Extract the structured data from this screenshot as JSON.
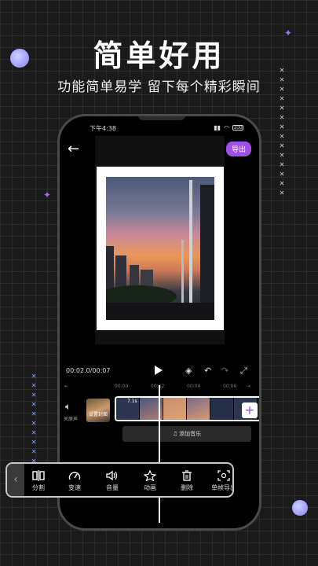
{
  "headline": "简单好用",
  "subheadline": "功能简单易学  留下每个精彩瞬间",
  "status_bar": {
    "time": "下午4:38",
    "battery": "100"
  },
  "editor": {
    "export_label": "导出",
    "time_display": "00:02.0/00:07",
    "ruler": [
      "00:00",
      "00:02",
      "00:04",
      "00:06"
    ],
    "sound_label": "关原声",
    "cover_label": "设置封面",
    "clip_duration": "7.1s",
    "add_music_label": "添加音乐"
  },
  "toolbar": {
    "items": [
      {
        "label": "分割",
        "icon": "split-icon"
      },
      {
        "label": "变速",
        "icon": "speed-icon"
      },
      {
        "label": "音量",
        "icon": "volume-icon"
      },
      {
        "label": "动画",
        "icon": "star-icon"
      },
      {
        "label": "删除",
        "icon": "trash-icon"
      },
      {
        "label": "单帧导出",
        "icon": "frame-export-icon"
      }
    ]
  },
  "colors": {
    "accent": "#a050e8",
    "background": "#1a1a1a",
    "bubble": "#8b7bff",
    "cross_blue": "#8ea2ff"
  }
}
